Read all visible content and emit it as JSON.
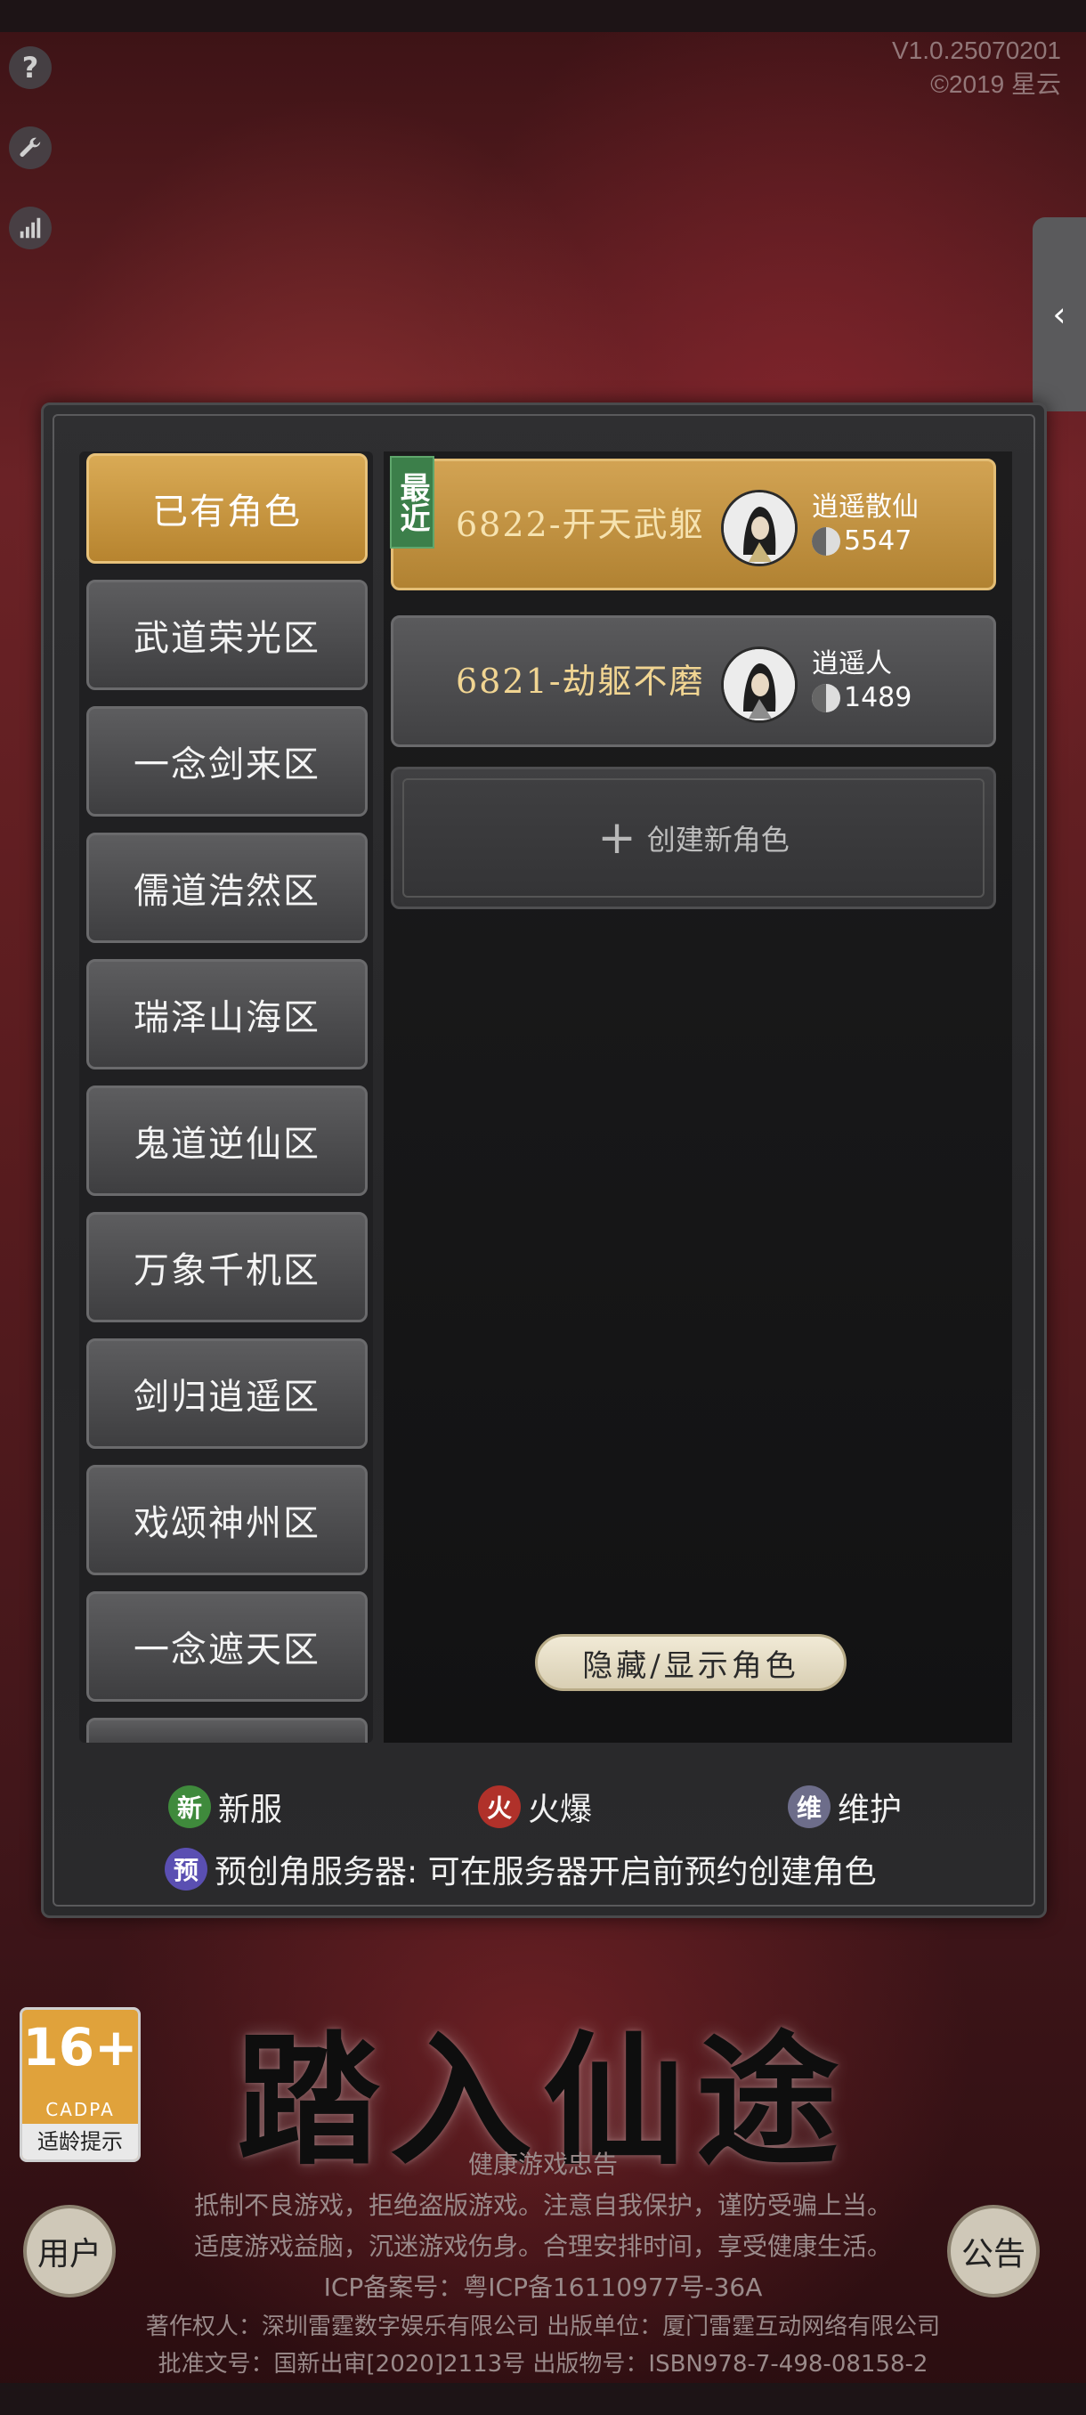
{
  "version": {
    "line1": "V1.0.25070201",
    "line2": "©2019 星云"
  },
  "side_icons": [
    "help-icon",
    "wrench-icon",
    "signal-icon"
  ],
  "collapse_arrow": "‹",
  "servers": [
    {
      "label": "已有角色",
      "active": true
    },
    {
      "label": "武道荣光区"
    },
    {
      "label": "一念剑来区"
    },
    {
      "label": "儒道浩然区"
    },
    {
      "label": "瑞泽山海区"
    },
    {
      "label": "鬼道逆仙区"
    },
    {
      "label": "万象千机区"
    },
    {
      "label": "剑归逍遥区"
    },
    {
      "label": "戏颂神州区"
    },
    {
      "label": "一念遮天区"
    }
  ],
  "roles": [
    {
      "tag": "最近",
      "name": "6822-开天武躯",
      "realm": "逍遥散仙",
      "power": "5547"
    },
    {
      "name": "6821-劫躯不磨",
      "realm": "逍遥人",
      "power": "1489"
    }
  ],
  "create_role": {
    "plus": "+",
    "label": "创建新角色"
  },
  "toggle_button": "隐藏/显示角色",
  "legend": {
    "new": {
      "badge": "新",
      "label": "新服",
      "color": "#3f8a3c"
    },
    "hot": {
      "badge": "火",
      "label": "火爆",
      "color": "#b0312a"
    },
    "maint": {
      "badge": "维",
      "label": "维护",
      "color": "#6d6d8a"
    },
    "pre": {
      "badge": "预",
      "label": "预创角服务器: 可在服务器开启前预约创建角色",
      "color": "#5a4fb2"
    }
  },
  "title": "踏入仙途",
  "age_rating": {
    "number": "16+",
    "org": "CADPA",
    "label": "适龄提示"
  },
  "user_button": "用户",
  "notice_button": "公告",
  "notice": {
    "title": "健康游戏忠告",
    "line1": "抵制不良游戏，拒绝盗版游戏。注意自我保护，谨防受骗上当。",
    "line2": "适度游戏益脑，沉迷游戏伤身。合理安排时间，享受健康生活。",
    "icp": "ICP备案号：粤ICP备16110977号-36A",
    "copyright": "著作权人：深圳雷霆数字娱乐有限公司 出版单位：厦门雷霆互动网络有限公司",
    "approval": "批准文号：国新出审[2020]2113号 出版物号：ISBN978-7-498-08158-2"
  }
}
